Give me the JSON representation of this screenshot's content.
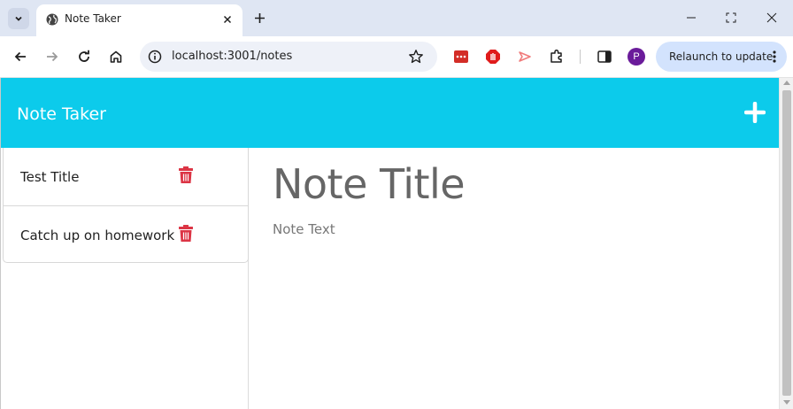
{
  "browser": {
    "tab_title": "Note Taker",
    "url": "localhost:3001/notes",
    "relaunch_label": "Relaunch to update",
    "avatar_initial": "P"
  },
  "app": {
    "brand": "Note Taker",
    "notes": [
      {
        "title": "Test Title"
      },
      {
        "title": "Catch up on homework"
      }
    ],
    "editor": {
      "title_placeholder": "Note Title",
      "text_placeholder": "Note Text"
    }
  },
  "colors": {
    "navbar": "#0ccbeb",
    "trash": "#dc3545",
    "avatar": "#6a1b9a",
    "relaunch_bg": "#d3e3fd"
  },
  "icons": {
    "tab_search": "chevron-down-icon",
    "favicon": "globe-icon",
    "add_note": "plus-icon",
    "delete_note": "trash-icon"
  }
}
